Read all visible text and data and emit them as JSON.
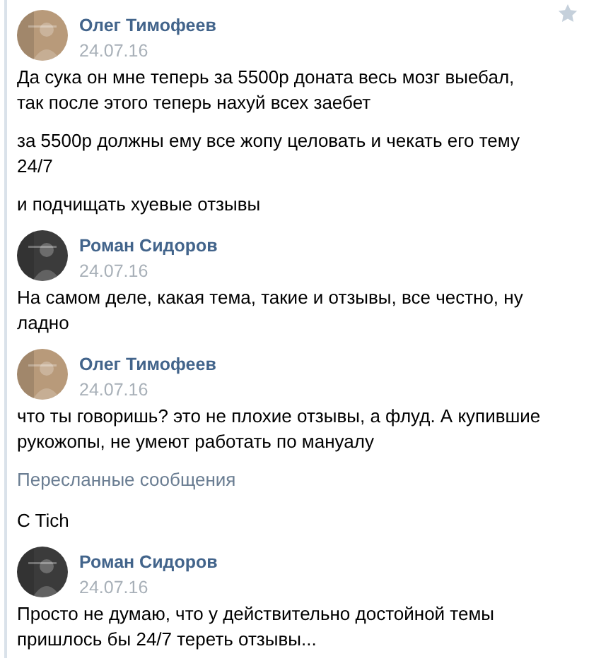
{
  "starred": false,
  "items": [
    {
      "kind": "message",
      "author": "Олег Тимофеев",
      "date": "24.07.16",
      "paragraphs": [
        "Да сука он мне теперь за 5500р доната весь мозг выебал, так после этого теперь нахуй всех заебет",
        "за 5500р должны ему все жопу целовать и чекать его тему 24/7",
        "и подчищать хуевые отзывы"
      ]
    },
    {
      "kind": "message",
      "author": "Роман Сидоров",
      "date": "24.07.16",
      "paragraphs": [
        "На самом деле, какая тема, такие и отзывы, все честно, ну ладно"
      ]
    },
    {
      "kind": "message",
      "author": "Олег Тимофеев",
      "date": "24.07.16",
      "paragraphs": [
        "что ты говоришь? это не плохие отзывы, а флуд. А купившие рукожопы, не умеют работать по мануалу"
      ]
    },
    {
      "kind": "forwarded_label",
      "text": "Пересланные сообщения"
    },
    {
      "kind": "text",
      "text": "C Tich"
    },
    {
      "kind": "message",
      "author": "Роман Сидоров",
      "date": "24.07.16",
      "paragraphs": [
        "Просто не думаю, что у действительно достойной темы пришлось бы 24/7 тереть отзывы..."
      ]
    }
  ]
}
